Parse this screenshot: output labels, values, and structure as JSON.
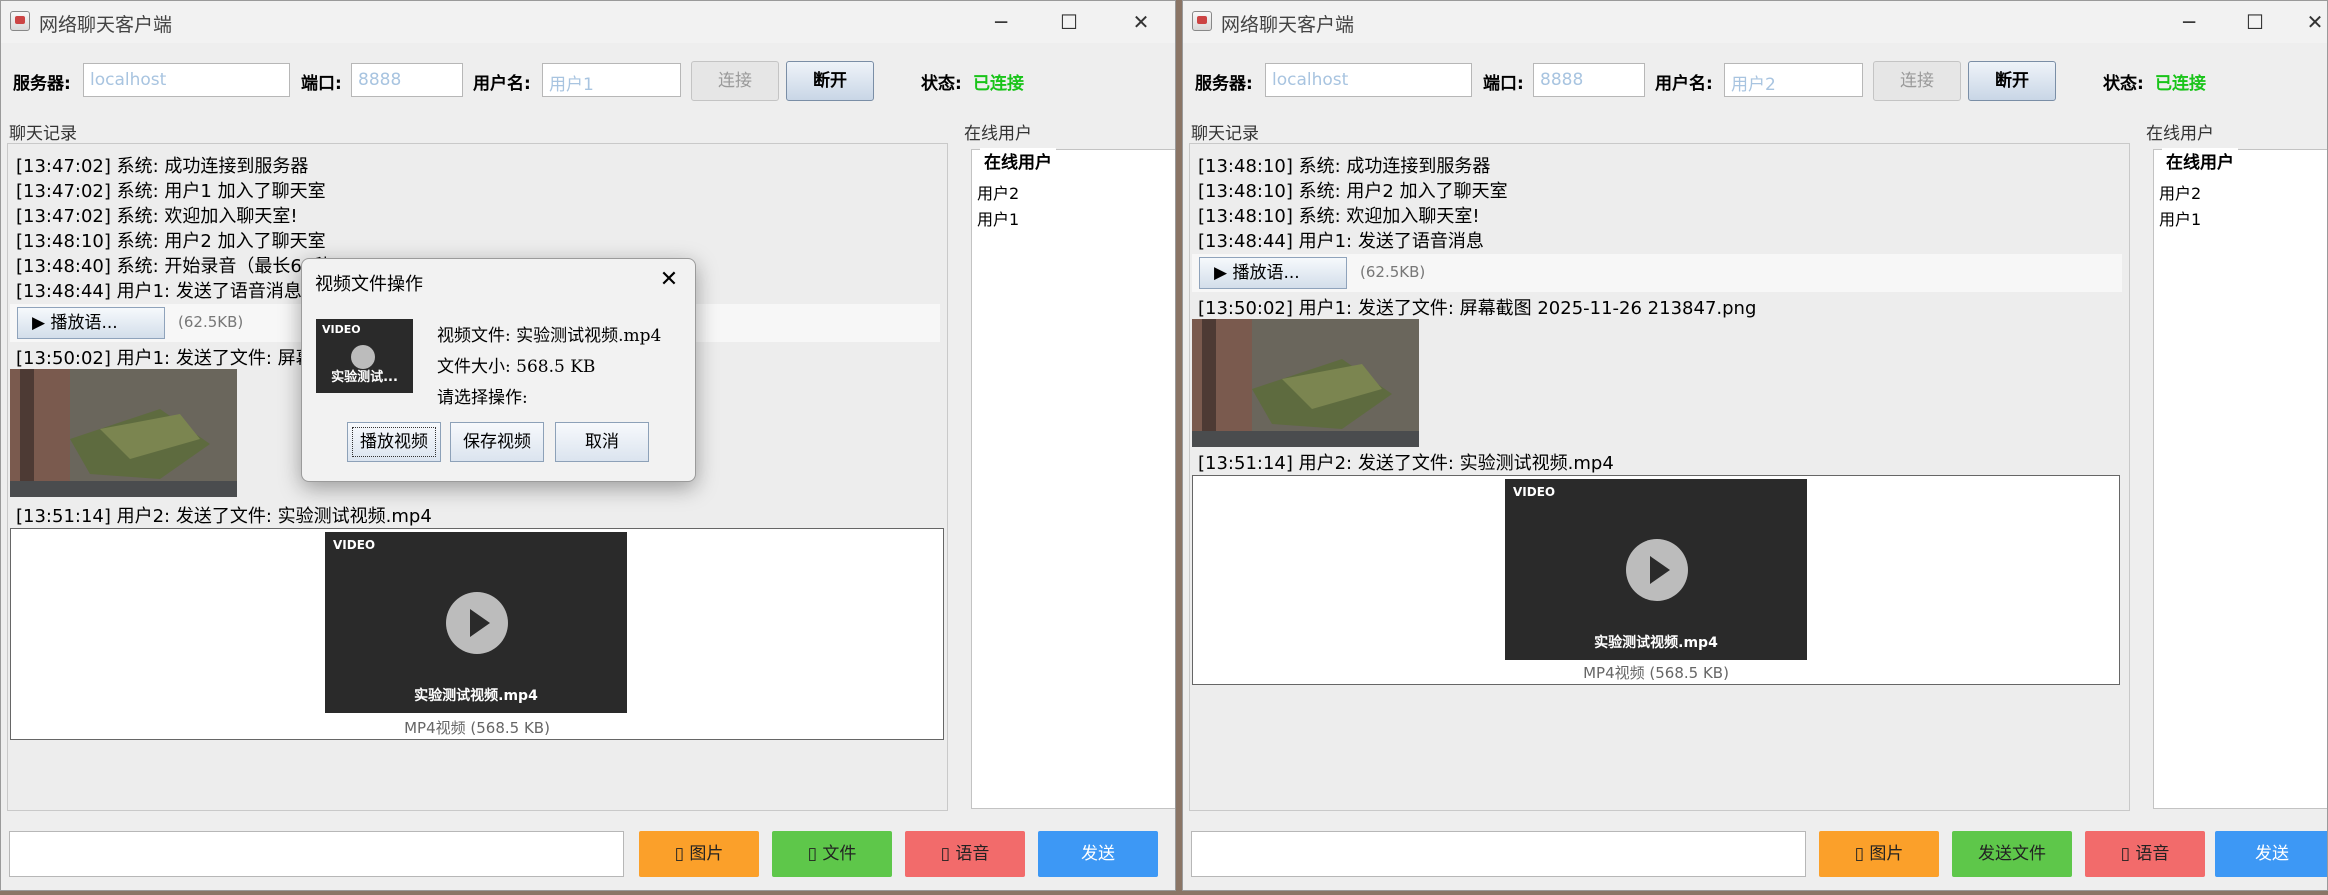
{
  "window_left": {
    "title": "网络聊天客户端",
    "server_label": "服务器:",
    "server_value": "localhost",
    "port_label": "端口:",
    "port_value": "8888",
    "username_label": "用户名:",
    "username_value": "用户1",
    "connect_label": "连接",
    "disconnect_label": "断开",
    "status_label": "状态:",
    "status_value": "已连接",
    "chat_section": "聊天记录",
    "users_section": "在线用户",
    "users_legend": "在线用户",
    "online_users": [
      "用户2",
      "用户1"
    ],
    "messages": [
      "[13:47:02] 系统: 成功连接到服务器",
      "[13:47:02] 系统: 用户1 加入了聊天室",
      "[13:47:02] 系统: 欢迎加入聊天室!",
      "[13:48:10] 系统: 用户2 加入了聊天室",
      "[13:48:40] 系统: 开始录音（最长60秒",
      "[13:48:44] 用户1: 发送了语音消息",
      "[13:50:02] 用户1: 发送了文件: 屏幕截",
      "[13:51:14] 用户2: 发送了文件: 实验测试视频.mp4"
    ],
    "voice_button": "▶ 播放语...",
    "voice_size": "(62.5KB)",
    "video_tag": "VIDEO",
    "video_name": "实验测试视频.mp4",
    "video_caption": "MP4视频 (568.5 KB)",
    "btn_image": "▯ 图片",
    "btn_file": "▯ 文件",
    "btn_voice": "▯ 语音",
    "btn_send": "发送"
  },
  "dialog": {
    "title": "视频文件操作",
    "thumb_tag": "VIDEO",
    "thumb_name": "实验测试...",
    "file_line": "视频文件: 实验测试视频.mp4",
    "size_line": "文件大小: 568.5 KB",
    "prompt_line": "请选择操作:",
    "play_button": "播放视频",
    "save_button": "保存视频",
    "cancel_button": "取消"
  },
  "window_right": {
    "title": "网络聊天客户端",
    "server_label": "服务器:",
    "server_value": "localhost",
    "port_label": "端口:",
    "port_value": "8888",
    "username_label": "用户名:",
    "username_value": "用户2",
    "connect_label": "连接",
    "disconnect_label": "断开",
    "status_label": "状态:",
    "status_value": "已连接",
    "chat_section": "聊天记录",
    "users_section": "在线用户",
    "users_legend": "在线用户",
    "online_users": [
      "用户2",
      "用户1"
    ],
    "messages": [
      "[13:48:10] 系统: 成功连接到服务器",
      "[13:48:10] 系统: 用户2 加入了聊天室",
      "[13:48:10] 系统: 欢迎加入聊天室!",
      "[13:48:44] 用户1: 发送了语音消息",
      "[13:50:02] 用户1: 发送了文件: 屏幕截图 2025-11-26 213847.png",
      "[13:51:14] 用户2: 发送了文件: 实验测试视频.mp4"
    ],
    "voice_button": "▶ 播放语...",
    "voice_size": "(62.5KB)",
    "video_tag": "VIDEO",
    "video_name": "实验测试视频.mp4",
    "video_caption": "MP4视频 (568.5 KB)",
    "btn_image": "▯ 图片",
    "btn_file": "发送文件",
    "btn_voice": "▯ 语音",
    "btn_send": "发送"
  }
}
